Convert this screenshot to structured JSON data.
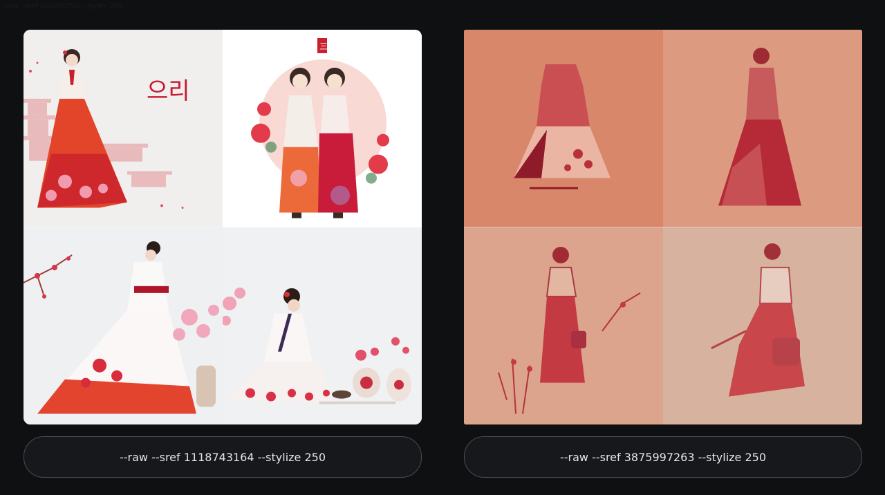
{
  "top_note": "--raw --sref 2636582706 --stylize 250",
  "cards": [
    {
      "caption": "--raw --sref 1118743164 --stylize 250",
      "tiles": [
        {
          "icon": "hanbok-woman-with-pagoda-image",
          "calligraphy": "으리"
        },
        {
          "icon": "two-girls-in-hanbok-image",
          "seal": "三"
        },
        {
          "icon": "woman-white-hanbok-blossoms-image"
        },
        {
          "icon": "kneeling-woman-with-vases-image"
        }
      ]
    },
    {
      "caption": "--raw --sref 3875997263 --stylize 250",
      "tiles": [
        {
          "icon": "hanbok-dress-sketch-image"
        },
        {
          "icon": "woman-sketch-red-image"
        },
        {
          "icon": "woman-with-bag-sketch-image"
        },
        {
          "icon": "walking-woman-sketch-image"
        }
      ]
    }
  ]
}
